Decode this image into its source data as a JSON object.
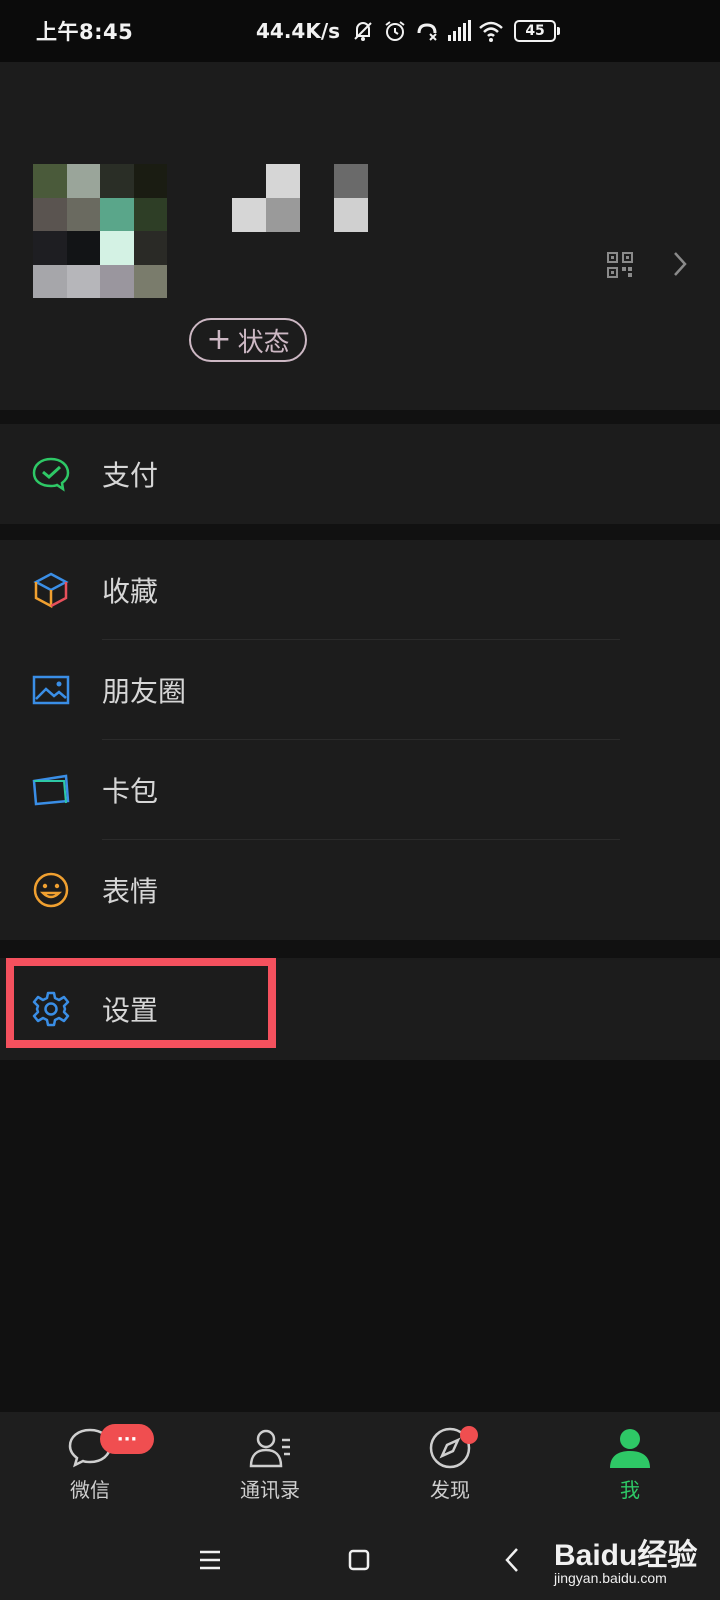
{
  "status_bar": {
    "time": "上午8:45",
    "speed": "44.4K/s",
    "battery": "45",
    "icons": [
      "mute-bell-icon",
      "alarm-icon",
      "call-icon",
      "signal-icon",
      "wifi-icon",
      "battery-icon"
    ]
  },
  "profile": {
    "status_button": "状态",
    "qr_icon": "qr-code-icon",
    "chevron_icon": "chevron-right-icon"
  },
  "menu": {
    "pay": {
      "label": "支付",
      "icon": "wechat-pay-icon",
      "color": "#2ec866"
    },
    "favorites": {
      "label": "收藏",
      "icon": "favorites-cube-icon"
    },
    "moments": {
      "label": "朋友圈",
      "icon": "moments-image-icon",
      "color": "#3a8ee6"
    },
    "cards": {
      "label": "卡包",
      "icon": "card-wallet-icon",
      "color": "#3a8ee6"
    },
    "stickers": {
      "label": "表情",
      "icon": "smiley-icon",
      "color": "#f0a030"
    },
    "settings": {
      "label": "设置",
      "icon": "gear-icon",
      "color": "#3a8ee6"
    }
  },
  "tabs": [
    {
      "label": "微信",
      "icon": "chat-icon",
      "badge": "···"
    },
    {
      "label": "通讯录",
      "icon": "contacts-icon"
    },
    {
      "label": "发现",
      "icon": "compass-icon"
    },
    {
      "label": "我",
      "icon": "me-icon",
      "active": true
    }
  ],
  "nav": {
    "menu_icon": "menu-icon",
    "home_icon": "home-square-icon",
    "back_icon": "back-chevron-icon"
  },
  "watermark": {
    "main": "Baidu经验",
    "sub": "jingyan.baidu.com"
  }
}
